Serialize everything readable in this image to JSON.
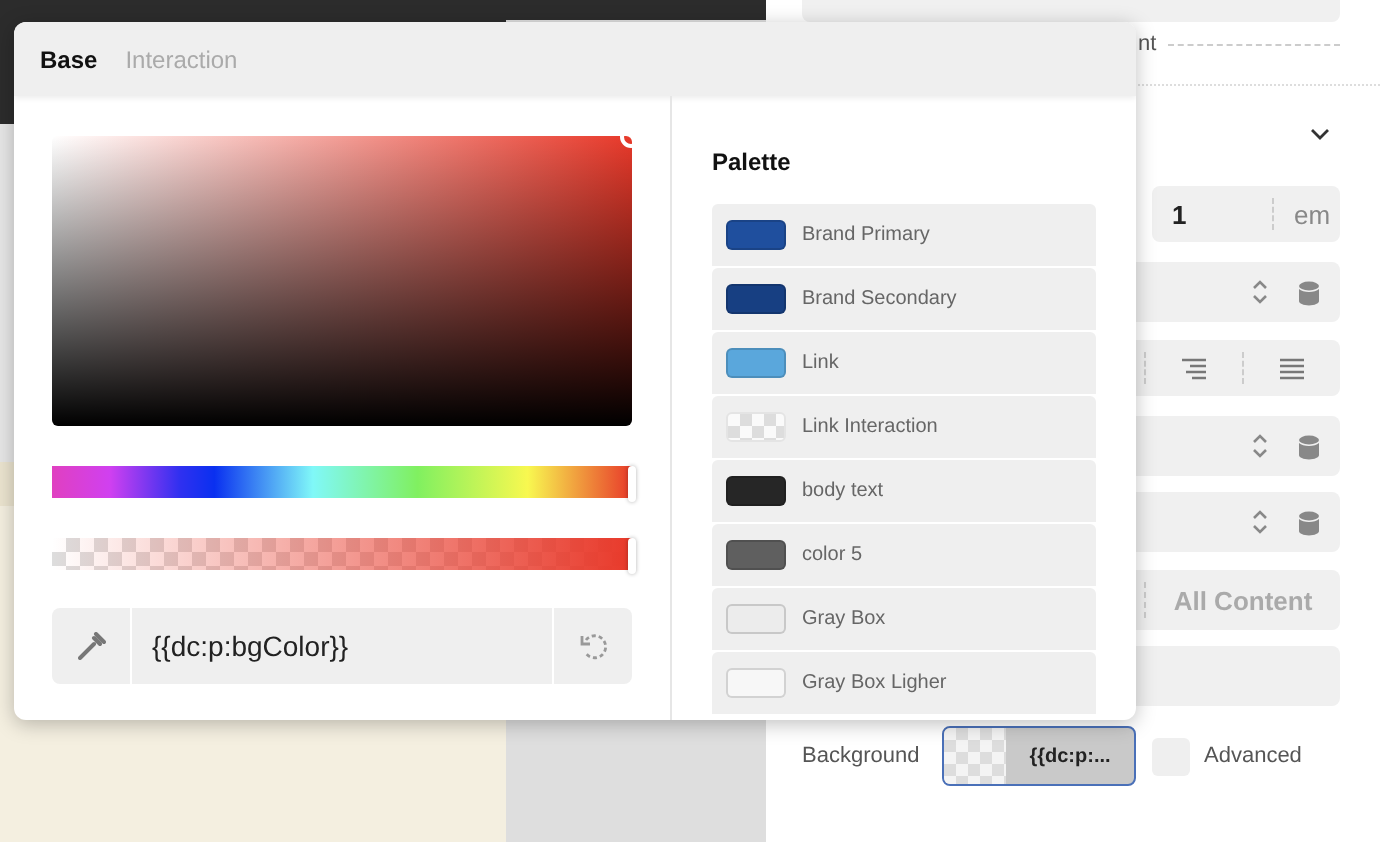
{
  "popup": {
    "tabs": [
      {
        "label": "Base",
        "selected": true
      },
      {
        "label": "Interaction",
        "selected": false
      }
    ],
    "hue_slider": {
      "level": 1
    },
    "alpha_slider": {
      "level": 1
    },
    "color_field": {
      "value": "{{dc:p:bgColor}}"
    },
    "palette": {
      "title": "Palette",
      "items": [
        {
          "name": "Brand Primary",
          "kind": "solid",
          "color": "#1f4f9e"
        },
        {
          "name": "Brand Secondary",
          "kind": "solid",
          "color": "#173f82"
        },
        {
          "name": "Link",
          "kind": "solid",
          "color": "#5aa7dc"
        },
        {
          "name": "Link Interaction",
          "kind": "transparent"
        },
        {
          "name": "body text",
          "kind": "solid",
          "color": "#262626"
        },
        {
          "name": "color 5",
          "kind": "solid",
          "color": "#5f5f5f"
        },
        {
          "name": "Gray Box",
          "kind": "solid",
          "color": "#ececec"
        },
        {
          "name": "Gray Box Ligher",
          "kind": "solid",
          "color": "#f7f7f7"
        }
      ]
    }
  },
  "side_panel": {
    "partial_label": "nt",
    "size_field": {
      "value": "1",
      "unit": "em"
    },
    "content_button": "All Content",
    "background": {
      "label": "Background",
      "value": "{{dc:p:..."
    },
    "advanced": {
      "label": "Advanced",
      "checked": false
    }
  }
}
